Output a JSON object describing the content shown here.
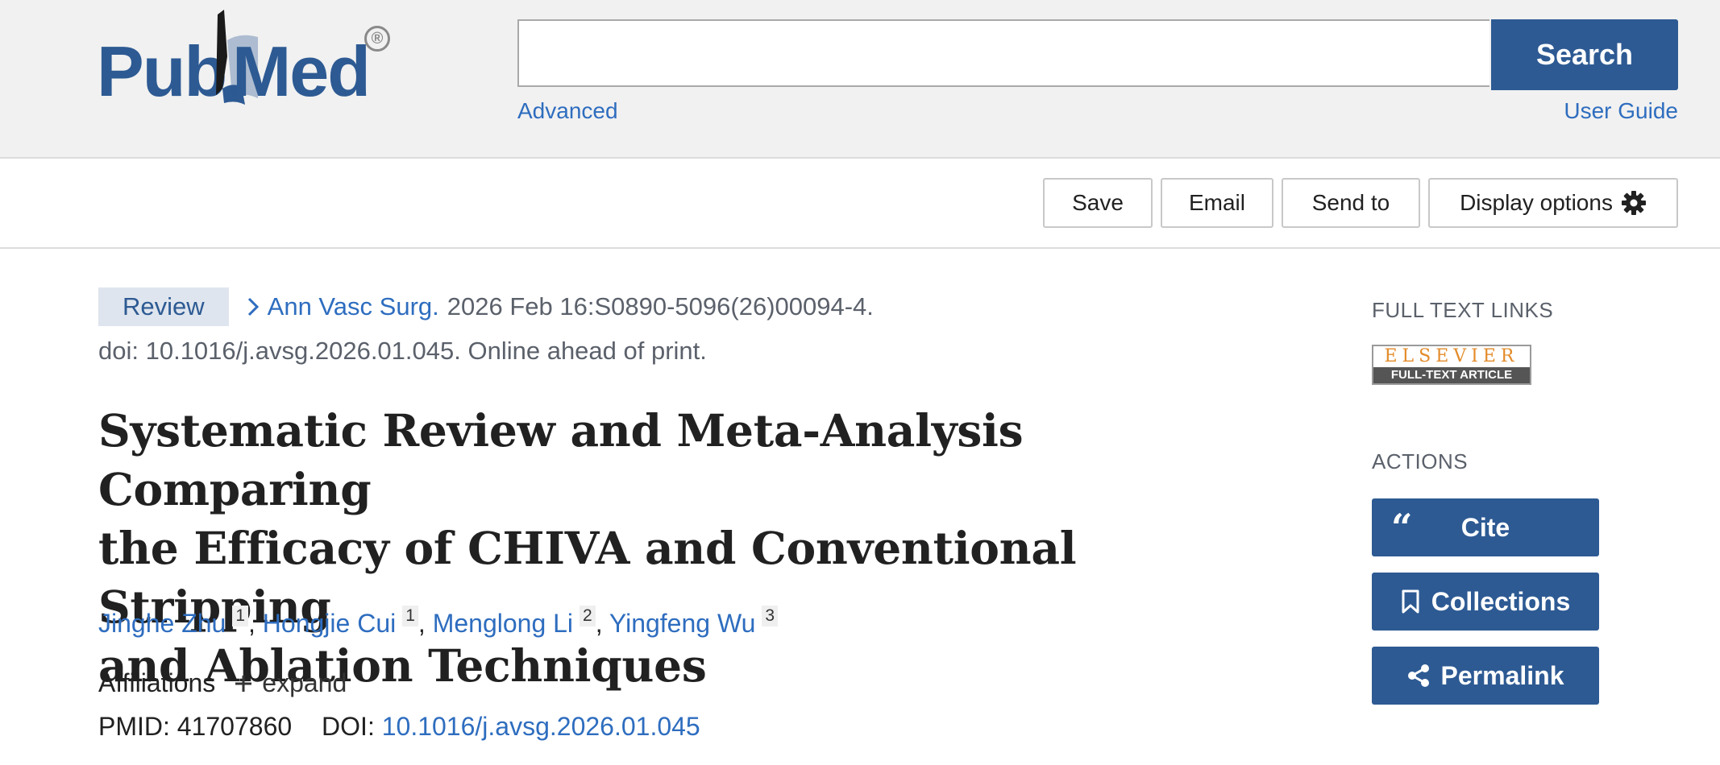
{
  "logo": {
    "pub": "Pub",
    "med": "Med",
    "registered": "®"
  },
  "search": {
    "placeholder": "",
    "button_label": "Search",
    "advanced_link": "Advanced",
    "user_guide_link": "User Guide"
  },
  "toolbar": {
    "save": "Save",
    "email": "Email",
    "send_to": "Send to",
    "display_options": "Display options"
  },
  "article": {
    "type_badge": "Review",
    "journal": "Ann Vasc Surg.",
    "citation": "2026 Feb 16:S0890-5096(26)00094-4.",
    "doi_line": "doi: 10.1016/j.avsg.2026.01.045. Online ahead of print.",
    "title_lines": [
      "Systematic Review and Meta-Analysis Comparing",
      "the Efficacy of CHIVA and Conventional Stripping",
      "and Ablation Techniques"
    ],
    "authors": [
      {
        "name": "Jinghe Zhu",
        "aff": "1"
      },
      {
        "name": "Hongjie Cui",
        "aff": "1"
      },
      {
        "name": "Menglong Li",
        "aff": "2"
      },
      {
        "name": "Yingfeng Wu",
        "aff": "3"
      }
    ],
    "author_separator": ",",
    "affiliations_label": "Affiliations",
    "expand_label": "expand",
    "pmid_label": "PMID:",
    "pmid": "41707860",
    "doi_label": "DOI:",
    "doi": "10.1016/j.avsg.2026.01.045"
  },
  "sidebar": {
    "full_text_links_heading": "FULL TEXT LINKS",
    "elsevier_brand": "ELSEVIER",
    "elsevier_caption": "FULL-TEXT ARTICLE",
    "actions_heading": "ACTIONS",
    "cite": "Cite",
    "collections": "Collections",
    "permalink": "Permalink"
  },
  "colors": {
    "brand_blue": "#2d5a93",
    "link_blue": "#2e6dbf",
    "header_bg": "#f1f1f1",
    "badge_bg": "#dfe5ee",
    "elsevier_orange": "#e38b2a"
  },
  "icons": [
    "pubmed-book-logo",
    "chevron-right-icon",
    "gear-icon",
    "plus-icon",
    "quote-icon",
    "bookmark-icon",
    "share-icon"
  ]
}
